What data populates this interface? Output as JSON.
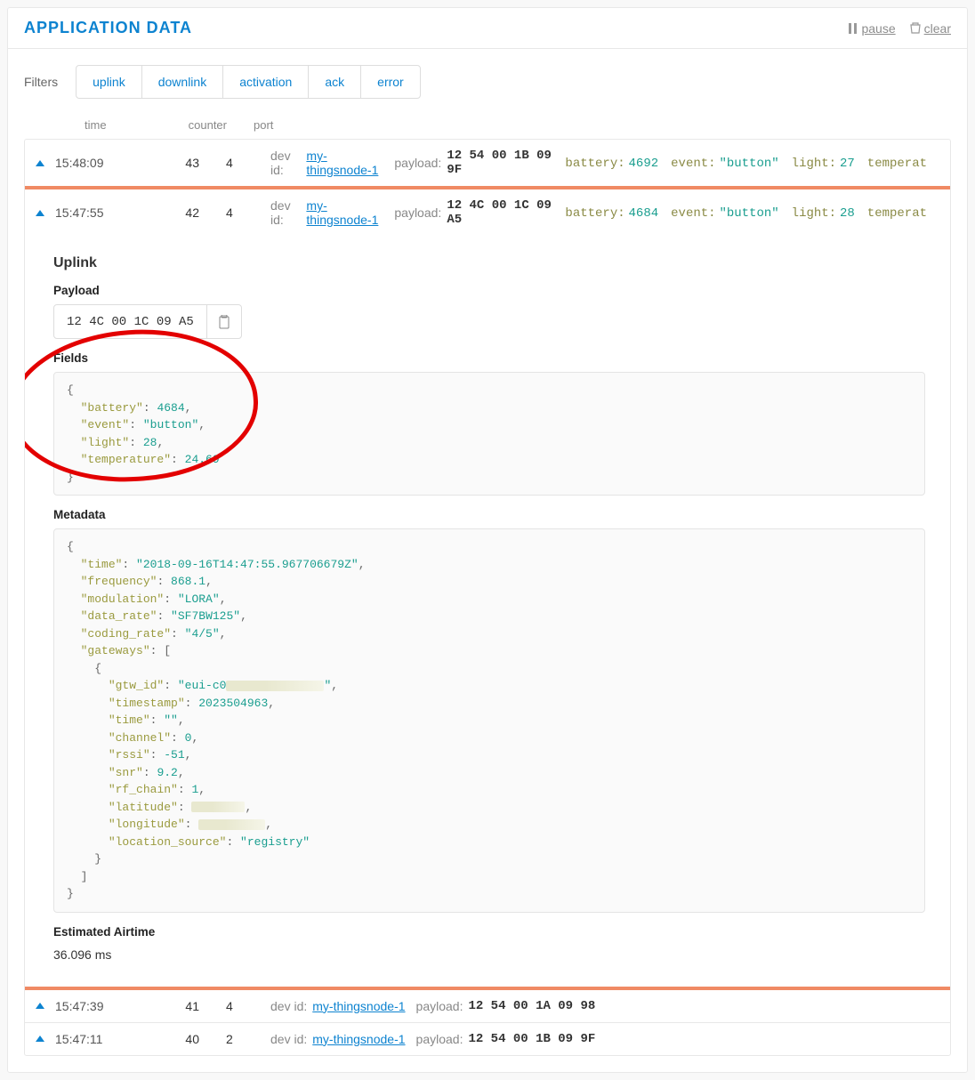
{
  "header": {
    "title": "APPLICATION DATA",
    "pause": "pause",
    "clear": "clear"
  },
  "filters": {
    "label": "Filters",
    "items": [
      "uplink",
      "downlink",
      "activation",
      "ack",
      "error"
    ]
  },
  "columns": {
    "time": "time",
    "counter": "counter",
    "port": "port"
  },
  "labels": {
    "dev_id": "dev id:",
    "payload": "payload:",
    "battery": "battery:",
    "event": "event:",
    "light": "light:",
    "temperature": "temperat"
  },
  "rows": [
    {
      "time": "15:48:09",
      "counter": 43,
      "port": 4,
      "dev_id": "my-thingsnode-1",
      "payload": "12 54 00 1B 09 9F",
      "battery": 4692,
      "event": "\"button\"",
      "light": 27
    },
    {
      "time": "15:47:55",
      "counter": 42,
      "port": 4,
      "dev_id": "my-thingsnode-1",
      "payload": "12 4C 00 1C 09 A5",
      "battery": 4684,
      "event": "\"button\"",
      "light": 28
    },
    {
      "time": "15:47:39",
      "counter": 41,
      "port": 4,
      "dev_id": "my-thingsnode-1",
      "payload": "12 54 00 1A 09 98"
    },
    {
      "time": "15:47:11",
      "counter": 40,
      "port": 2,
      "dev_id": "my-thingsnode-1",
      "payload": "12 54 00 1B 09 9F"
    }
  ],
  "detail": {
    "heading": "Uplink",
    "payload_label": "Payload",
    "payload_value": "12 4C 00 1C 09 A5",
    "fields_label": "Fields",
    "fields": {
      "battery": 4684,
      "event": "button",
      "light": 28,
      "temperature": 24.69
    },
    "metadata_label": "Metadata",
    "metadata": {
      "time": "2018-09-16T14:47:55.967706679Z",
      "frequency": 868.1,
      "modulation": "LORA",
      "data_rate": "SF7BW125",
      "coding_rate": "4/5",
      "gateways": [
        {
          "gtw_id_prefix": "eui-c0",
          "timestamp": 2023504963,
          "time": "",
          "channel": 0,
          "rssi": -51,
          "snr": 9.2,
          "rf_chain": 1,
          "latitude": "",
          "longitude": "",
          "location_source": "registry"
        }
      ]
    },
    "airtime_label": "Estimated Airtime",
    "airtime_value": "36.096 ms"
  }
}
